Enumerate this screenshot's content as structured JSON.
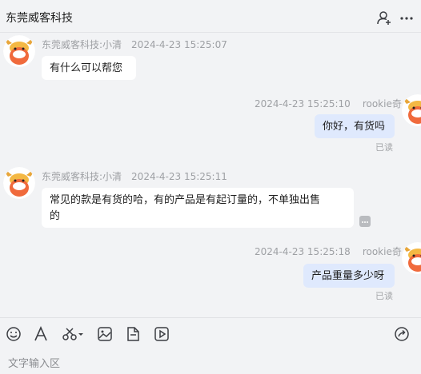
{
  "header": {
    "title": "东莞威客科技"
  },
  "messages": [
    {
      "side": "left",
      "sender": "东莞威客科技:小清",
      "time": "2024-4-23 15:25:07",
      "text": "有什么可以帮您"
    },
    {
      "side": "right",
      "sender": "rookie奇",
      "time": "2024-4-23 15:25:10",
      "text": "你好，有货吗",
      "status": "已读"
    },
    {
      "side": "left",
      "sender": "东莞威客科技:小清",
      "time": "2024-4-23 15:25:11",
      "line1": "常见的款是有货的哈，有的产品是有起订量的，不单独出售",
      "line2": "的"
    },
    {
      "side": "right",
      "sender": "rookie奇",
      "time": "2024-4-23 15:25:18",
      "text": "产品重量多少呀",
      "status": "已读"
    }
  ],
  "composer": {
    "placeholder": "文字输入区"
  },
  "colors": {
    "background": "#f2f3f5",
    "left_bubble": "#ffffff",
    "right_bubble": "#dfe9fd",
    "meta_text": "#9ea0a4"
  },
  "icons": {
    "header": [
      "add-contact-icon",
      "more-icon"
    ],
    "toolbar": [
      "emoji-icon",
      "font-icon",
      "scissors-icon",
      "image-icon",
      "file-icon",
      "video-icon",
      "share-icon"
    ]
  }
}
